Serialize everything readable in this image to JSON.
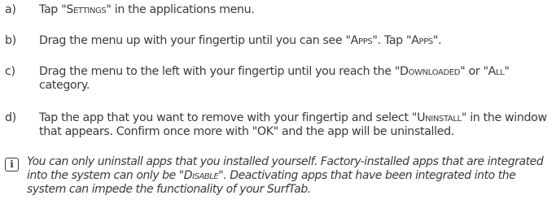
{
  "steps": [
    {
      "marker": "a)",
      "parts": [
        "Tap \"",
        "Settings",
        "\" in the applications menu."
      ]
    },
    {
      "marker": "b)",
      "parts": [
        "Drag the menu up with your fingertip until you can see \"",
        "Apps",
        "\". Tap \"",
        "Apps",
        "\"."
      ]
    },
    {
      "marker": "c)",
      "parts": [
        "Drag the menu to the left with your fingertip until you reach the \"",
        "Downloaded",
        "\" or \"",
        "All",
        "\" category."
      ]
    },
    {
      "marker": "d)",
      "parts": [
        "Tap the app that you want to remove with your fingertip and select \"",
        "Uninstall",
        "\" in the window that appears. Confirm once more with \"OK\" and the app will be uninstalled."
      ]
    }
  ],
  "note": {
    "icon": "info-icon",
    "icon_glyph": "i",
    "parts": [
      "You can only uninstall apps that you installed yourself. Factory-installed apps that are integrated into the system can only be \"",
      "Disable",
      "\". Deactivating apps that have been integrated into the system can impede the functionality of your SurfTab."
    ]
  }
}
